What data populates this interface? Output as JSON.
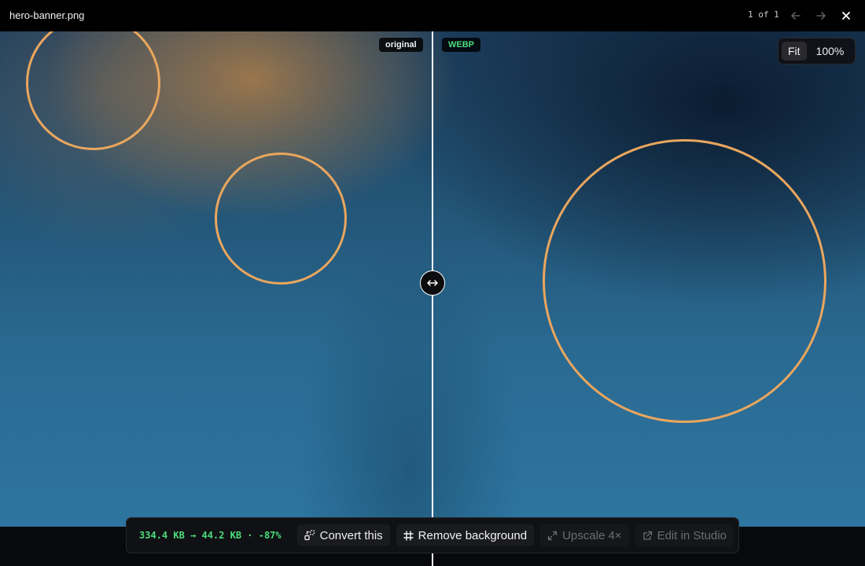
{
  "header": {
    "filename": "hero-banner.png",
    "counter": "1 of 1",
    "icons": {
      "prev": "arrow-left-icon",
      "next": "arrow-right-icon",
      "close": "close-icon"
    }
  },
  "compare": {
    "left_tag": "original",
    "right_tag": "WEBP",
    "handle_icon": "left-right-arrows-icon"
  },
  "zoom": {
    "fit_label": "Fit",
    "actual_label": "100%",
    "active": "Fit"
  },
  "toolbar": {
    "stats": "334.4 KB → 44.2 KB · -87%",
    "convert_label": "Convert this",
    "remove_bg_label": "Remove background",
    "upscale_label": "Upscale 4×",
    "studio_label": "Edit in Studio",
    "icons": {
      "convert": "convert-icon",
      "remove_bg": "crop-frame-icon",
      "upscale": "expand-arrows-icon",
      "studio": "external-link-icon"
    }
  },
  "colors": {
    "accent_green": "#4ddc7c",
    "ring": "#e9a65e",
    "divider": "#ffffff"
  }
}
